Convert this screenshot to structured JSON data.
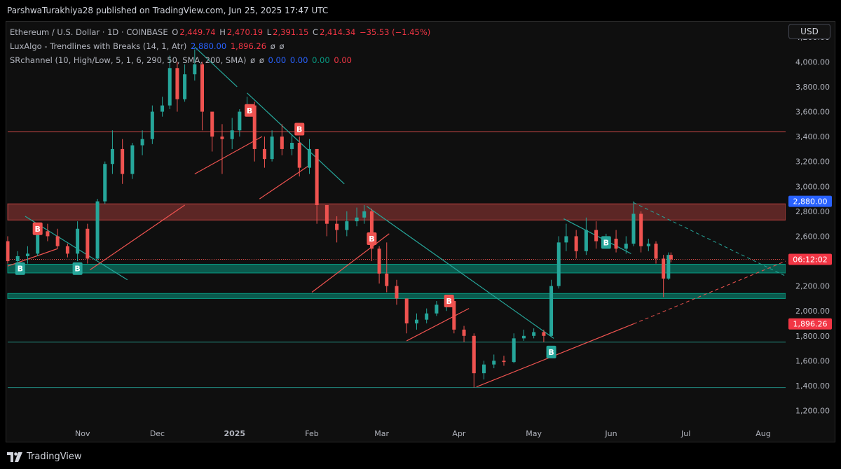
{
  "header": {
    "publisher": "ParshwaTurakhiya28 published on TradingView.com, Jun 25, 2025 17:47 UTC"
  },
  "legend": {
    "symbol": "Ethereum / U.S. Dollar · 1D · COINBASE",
    "o_label": "O",
    "o_val": "2,449.74",
    "h_label": "H",
    "h_val": "2,470.19",
    "l_label": "L",
    "l_val": "2,391.15",
    "c_label": "C",
    "c_val": "2,414.34",
    "change": "−35.53 (−1.45%)",
    "ind1_name": "LuxAlgo - Trendlines with Breaks (14, 1, Atr)",
    "ind1_v1": "2,880.00",
    "ind1_v2": "1,896.26",
    "ind1_n1": "ø",
    "ind1_n2": "ø",
    "ind2_name": "SRchannel (10, High/Low, 5, 1, 6, 290, 50, SMA, 200, SMA)",
    "ind2_n1": "ø",
    "ind2_n2": "ø",
    "ind2_v1": "0.00",
    "ind2_v2": "0.00",
    "ind2_v3": "0.00",
    "ind2_v4": "0.00"
  },
  "currency_button": "USD",
  "footer": {
    "brand": "TradingView"
  },
  "colors": {
    "up": "#26a69a",
    "down": "#ef5350",
    "bg": "#0f0f0f"
  },
  "chart_data": {
    "type": "candlestick",
    "symbol": "ETHUSD",
    "interval": "1D",
    "x_ticks": [
      "Nov",
      "Dec",
      "2025",
      "Feb",
      "Mar",
      "Apr",
      "May",
      "Jun",
      "Jul",
      "Aug"
    ],
    "y_ticks": [
      "1,200.00",
      "1,400.00",
      "1,600.00",
      "1,800.00",
      "2,000.00",
      "2,200.00",
      "2,400.00",
      "2,600.00",
      "2,800.00",
      "3,000.00",
      "3,200.00",
      "3,400.00",
      "3,600.00",
      "3,800.00",
      "4,000.00",
      "4,200.00"
    ],
    "y_range": [
      1130,
      4300
    ],
    "price_labels": [
      {
        "text": "2,880.00",
        "value": 2880,
        "color": "#2962ff"
      },
      {
        "text": "06:12:02",
        "value": 2414,
        "color": "#f23645"
      },
      {
        "text": "1,896.26",
        "value": 1896,
        "color": "#f23645"
      }
    ],
    "current_price": 2414.34,
    "resistance_zones": [
      {
        "from": 2730,
        "to": 2860,
        "color": "#ef5350"
      }
    ],
    "support_zones": [
      {
        "from": 2305,
        "to": 2375,
        "color": "#089981"
      },
      {
        "from": 2100,
        "to": 2140,
        "color": "#089981"
      }
    ],
    "horizontal_levels": [
      {
        "value": 3440,
        "color": "#ef5350"
      },
      {
        "value": 1750,
        "color": "#26a69a"
      },
      {
        "value": 1385,
        "color": "#26a69a"
      }
    ],
    "break_markers": [
      {
        "label": "B",
        "date": "2024-10-14",
        "price": 2660,
        "type": "sell"
      },
      {
        "label": "B",
        "date": "2024-10-07",
        "price": 2340,
        "type": "buy"
      },
      {
        "label": "B",
        "date": "2024-10-30",
        "price": 2340,
        "type": "buy"
      },
      {
        "label": "B",
        "date": "2025-01-07",
        "price": 3610,
        "type": "sell"
      },
      {
        "label": "B",
        "date": "2025-01-27",
        "price": 3460,
        "type": "sell"
      },
      {
        "label": "B",
        "date": "2025-02-25",
        "price": 2580,
        "type": "sell"
      },
      {
        "label": "B",
        "date": "2025-03-28",
        "price": 2080,
        "type": "sell"
      },
      {
        "label": "B",
        "date": "2025-05-08",
        "price": 1670,
        "type": "buy"
      },
      {
        "label": "B",
        "date": "2025-05-30",
        "price": 2550,
        "type": "buy"
      }
    ],
    "candles": [
      [
        "2024-10-02",
        2560,
        2600,
        2380,
        2400
      ],
      [
        "2024-10-06",
        2400,
        2480,
        2360,
        2440
      ],
      [
        "2024-10-10",
        2440,
        2520,
        2380,
        2460
      ],
      [
        "2024-10-14",
        2460,
        2690,
        2440,
        2640
      ],
      [
        "2024-10-18",
        2640,
        2700,
        2560,
        2600
      ],
      [
        "2024-10-22",
        2600,
        2660,
        2500,
        2520
      ],
      [
        "2024-10-26",
        2520,
        2540,
        2430,
        2460
      ],
      [
        "2024-10-30",
        2460,
        2720,
        2400,
        2660
      ],
      [
        "2024-11-03",
        2660,
        2700,
        2380,
        2420
      ],
      [
        "2024-11-07",
        2420,
        2900,
        2410,
        2880
      ],
      [
        "2024-11-10",
        2880,
        3200,
        2860,
        3180
      ],
      [
        "2024-11-13",
        3180,
        3450,
        3100,
        3300
      ],
      [
        "2024-11-17",
        3300,
        3380,
        3020,
        3100
      ],
      [
        "2024-11-21",
        3100,
        3350,
        3060,
        3330
      ],
      [
        "2024-11-25",
        3330,
        3450,
        3250,
        3380
      ],
      [
        "2024-11-29",
        3380,
        3650,
        3340,
        3600
      ],
      [
        "2024-12-03",
        3600,
        3720,
        3560,
        3650
      ],
      [
        "2024-12-06",
        3650,
        4050,
        3620,
        3950
      ],
      [
        "2024-12-09",
        3950,
        4000,
        3600,
        3700
      ],
      [
        "2024-12-12",
        3700,
        3980,
        3680,
        3900
      ],
      [
        "2024-12-16",
        3900,
        4100,
        3850,
        3980
      ],
      [
        "2024-12-19",
        3980,
        4000,
        3450,
        3600
      ],
      [
        "2024-12-23",
        3600,
        3550,
        3280,
        3400
      ],
      [
        "2024-12-27",
        3400,
        3500,
        3100,
        3380
      ],
      [
        "2024-12-31",
        3380,
        3550,
        3300,
        3450
      ],
      [
        "2025-01-03",
        3450,
        3620,
        3400,
        3600
      ],
      [
        "2025-01-06",
        3600,
        3720,
        3580,
        3650
      ],
      [
        "2025-01-09",
        3650,
        3680,
        3200,
        3300
      ],
      [
        "2025-01-13",
        3300,
        3400,
        3150,
        3220
      ],
      [
        "2025-01-16",
        3220,
        3450,
        3200,
        3400
      ],
      [
        "2025-01-20",
        3400,
        3500,
        3250,
        3300
      ],
      [
        "2025-01-24",
        3300,
        3420,
        3250,
        3350
      ],
      [
        "2025-01-27",
        3350,
        3400,
        3080,
        3150
      ],
      [
        "2025-01-31",
        3150,
        3380,
        3100,
        3300
      ],
      [
        "2025-02-03",
        3300,
        3080,
        2700,
        2850
      ],
      [
        "2025-02-07",
        2850,
        2800,
        2600,
        2700
      ],
      [
        "2025-02-11",
        2700,
        2760,
        2550,
        2650
      ],
      [
        "2025-02-15",
        2650,
        2800,
        2600,
        2720
      ],
      [
        "2025-02-19",
        2720,
        2830,
        2680,
        2750
      ],
      [
        "2025-02-22",
        2750,
        2850,
        2700,
        2800
      ],
      [
        "2025-02-25",
        2800,
        2820,
        2400,
        2500
      ],
      [
        "2025-02-28",
        2500,
        2520,
        2220,
        2300
      ],
      [
        "2025-03-03",
        2300,
        2550,
        2150,
        2200
      ],
      [
        "2025-03-07",
        2200,
        2250,
        2050,
        2100
      ],
      [
        "2025-03-11",
        2100,
        2000,
        1820,
        1900
      ],
      [
        "2025-03-15",
        1900,
        1980,
        1850,
        1930
      ],
      [
        "2025-03-19",
        1930,
        2020,
        1900,
        1980
      ],
      [
        "2025-03-23",
        1980,
        2080,
        1960,
        2050
      ],
      [
        "2025-03-27",
        2050,
        2120,
        2000,
        2080
      ],
      [
        "2025-03-30",
        2080,
        2100,
        1820,
        1850
      ],
      [
        "2025-04-03",
        1850,
        1880,
        1750,
        1800
      ],
      [
        "2025-04-07",
        1800,
        1820,
        1385,
        1500
      ],
      [
        "2025-04-11",
        1500,
        1600,
        1450,
        1570
      ],
      [
        "2025-04-15",
        1570,
        1650,
        1540,
        1600
      ],
      [
        "2025-04-19",
        1600,
        1640,
        1560,
        1590
      ],
      [
        "2025-04-23",
        1590,
        1820,
        1580,
        1780
      ],
      [
        "2025-04-27",
        1780,
        1850,
        1760,
        1800
      ],
      [
        "2025-05-01",
        1800,
        1860,
        1780,
        1830
      ],
      [
        "2025-05-05",
        1830,
        1850,
        1750,
        1800
      ],
      [
        "2025-05-08",
        1800,
        2250,
        1790,
        2200
      ],
      [
        "2025-05-11",
        2200,
        2600,
        2180,
        2550
      ],
      [
        "2025-05-14",
        2550,
        2700,
        2480,
        2600
      ],
      [
        "2025-05-18",
        2600,
        2650,
        2420,
        2480
      ],
      [
        "2025-05-22",
        2480,
        2750,
        2450,
        2650
      ],
      [
        "2025-05-26",
        2650,
        2720,
        2500,
        2560
      ],
      [
        "2025-05-30",
        2560,
        2620,
        2500,
        2580
      ],
      [
        "2025-06-03",
        2580,
        2650,
        2470,
        2500
      ],
      [
        "2025-06-07",
        2500,
        2600,
        2460,
        2540
      ],
      [
        "2025-06-10",
        2540,
        2880,
        2520,
        2780
      ],
      [
        "2025-06-13",
        2780,
        2800,
        2470,
        2520
      ],
      [
        "2025-06-16",
        2520,
        2580,
        2480,
        2540
      ],
      [
        "2025-06-19",
        2540,
        2560,
        2380,
        2420
      ],
      [
        "2025-06-22",
        2420,
        2450,
        2111,
        2260
      ],
      [
        "2025-06-24",
        2260,
        2470,
        2250,
        2449.74
      ],
      [
        "2025-06-25",
        2449.74,
        2470.19,
        2391.15,
        2414.34
      ]
    ]
  }
}
